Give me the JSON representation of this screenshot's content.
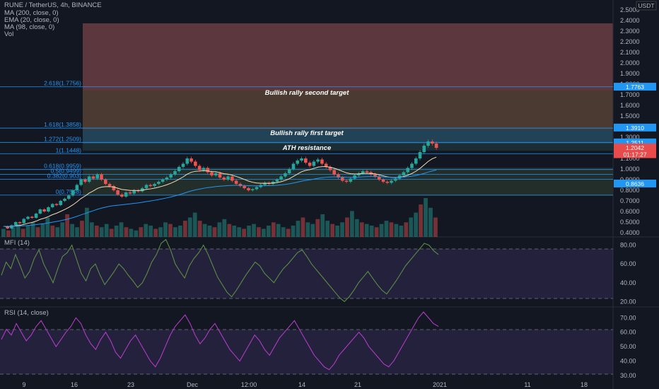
{
  "header": {
    "symbol_line": "RUNE / TetherUS, 4h, BINANCE",
    "indicators": [
      "MA (200, close, 0)",
      "EMA (20, close, 0)",
      "MA (98, close, 0)",
      "Vol"
    ],
    "currency": "USDT"
  },
  "panes": {
    "mfi_label": "MFI (14)",
    "rsi_label": "RSI (14, close)"
  },
  "annotations": {
    "second_target": "Bullish rally second target",
    "first_target": "Bullish rally first target",
    "ath": "ATH resistance"
  },
  "fib_levels": [
    {
      "label": "2.618(1.7756)",
      "value": 1.7756
    },
    {
      "label": "1.618(1.3858)",
      "value": 1.3858
    },
    {
      "label": "1.272(1.2509)",
      "value": 1.2509
    },
    {
      "label": "1(1.1448)",
      "value": 1.1448
    },
    {
      "label": "0.618(0.9959)",
      "value": 0.9959
    },
    {
      "label": "0.5(0.9499)",
      "value": 0.9499
    },
    {
      "label": "0.382(0.903)",
      "value": 0.903
    },
    {
      "label": "0(0.7548)",
      "value": 0.7548
    }
  ],
  "price_tags": [
    {
      "text": "1.7763",
      "value": 1.7763,
      "color": "#2196f3"
    },
    {
      "text": "1.3910",
      "value": 1.391,
      "color": "#2196f3"
    },
    {
      "text": "1.2511",
      "value": 1.2511,
      "color": "#2196f3"
    },
    {
      "text": "1.2042",
      "value": 1.2042,
      "color": "#e84b4b"
    },
    {
      "text": "01:17:27",
      "value": 1.14,
      "color": "#e84b4b"
    },
    {
      "text": "0.8636",
      "value": 0.8636,
      "color": "#2196f3"
    }
  ],
  "colors": {
    "background": "#131722",
    "up_candle": "#26a69a",
    "down_candle": "#ef5350",
    "fib_line": "#2196f3",
    "mfi_line": "#5d8c45",
    "rsi_line": "#b13bc4",
    "ema_line": "#f5deb3",
    "ma200_line": "#2196f3"
  },
  "chart_data": [
    {
      "type": "line",
      "pane": "price",
      "series_desc": "RUNE/USDT 4h closing price (approx)",
      "x_ticks": [
        "9",
        "16",
        "23",
        "Dec",
        "12:00",
        "14",
        "21",
        "2021",
        "11",
        "18"
      ],
      "ylim": [
        0.36,
        2.58
      ],
      "y_ticks": [
        2.5,
        2.4,
        2.3,
        2.2,
        2.1,
        2.0,
        1.9,
        1.8,
        1.7,
        1.6,
        1.5,
        1.4,
        1.3,
        1.2,
        1.1,
        1.0,
        0.9,
        0.8,
        0.7,
        0.6,
        0.5,
        0.4
      ],
      "y_tick_labels": [
        "2.5000",
        "2.4000",
        "2.3000",
        "2.2000",
        "2.1000",
        "2.0000",
        "1.9000",
        "1.8000",
        "1.7000",
        "1.6000",
        "1.5000",
        "1.4000",
        "1.3000",
        "1.2000",
        "1.1000",
        "1.0000",
        "0.9000",
        "0.8000",
        "0.7000",
        "0.6000",
        "0.5000",
        "0.4000"
      ],
      "close": [
        0.46,
        0.44,
        0.47,
        0.5,
        0.49,
        0.53,
        0.55,
        0.54,
        0.58,
        0.62,
        0.6,
        0.64,
        0.67,
        0.66,
        0.7,
        0.72,
        0.75,
        0.8,
        0.85,
        0.9,
        0.88,
        0.93,
        0.91,
        0.95,
        0.9,
        0.86,
        0.84,
        0.8,
        0.76,
        0.74,
        0.78,
        0.77,
        0.8,
        0.79,
        0.82,
        0.85,
        0.84,
        0.86,
        0.88,
        0.9,
        0.92,
        0.95,
        0.98,
        1.02,
        1.05,
        1.1,
        1.07,
        1.03,
        0.99,
        1.01,
        0.97,
        0.94,
        0.96,
        0.92,
        0.9,
        0.93,
        0.89,
        0.86,
        0.84,
        0.82,
        0.8,
        0.81,
        0.83,
        0.85,
        0.87,
        0.86,
        0.88,
        0.9,
        0.93,
        0.96,
        1.0,
        1.05,
        1.08,
        1.1,
        1.06,
        1.03,
        1.07,
        1.09,
        1.05,
        1.02,
        0.99,
        0.95,
        0.92,
        0.89,
        0.88,
        0.91,
        0.94,
        0.96,
        0.98,
        0.97,
        0.95,
        0.93,
        0.9,
        0.88,
        0.87,
        0.89,
        0.91,
        0.94,
        0.97,
        1.01,
        1.05,
        1.1,
        1.16,
        1.22,
        1.26,
        1.24,
        1.2
      ]
    },
    {
      "type": "line",
      "pane": "MFI (14)",
      "ylim": [
        15,
        88
      ],
      "y_ticks": [
        80,
        60,
        40,
        20
      ],
      "y_tick_labels": [
        "80.00",
        "60.00",
        "40.00",
        "20.00"
      ],
      "values": [
        48,
        62,
        55,
        70,
        58,
        45,
        52,
        66,
        75,
        60,
        50,
        40,
        55,
        68,
        72,
        80,
        65,
        50,
        42,
        55,
        60,
        48,
        38,
        45,
        52,
        60,
        55,
        48,
        42,
        35,
        40,
        50,
        62,
        70,
        82,
        86,
        75,
        60,
        52,
        45,
        58,
        66,
        72,
        80,
        70,
        58,
        46,
        38,
        30,
        25,
        32,
        40,
        48,
        55,
        62,
        58,
        50,
        45,
        40,
        48,
        55,
        60,
        66,
        72,
        75,
        68,
        60,
        54,
        48,
        42,
        36,
        30,
        24,
        20,
        25,
        32,
        40,
        46,
        52,
        45,
        38,
        32,
        28,
        35,
        42,
        50,
        58,
        64,
        70,
        76,
        82,
        80,
        74,
        70
      ]
    },
    {
      "type": "line",
      "pane": "RSI (14, close)",
      "ylim": [
        27,
        77
      ],
      "y_ticks": [
        70,
        60,
        50,
        40,
        30
      ],
      "y_tick_labels": [
        "70.00",
        "60.00",
        "50.00",
        "40.00",
        "30.00"
      ],
      "values": [
        55,
        62,
        58,
        66,
        60,
        54,
        58,
        64,
        68,
        62,
        56,
        50,
        55,
        60,
        64,
        70,
        66,
        58,
        52,
        48,
        55,
        60,
        54,
        46,
        42,
        48,
        54,
        58,
        52,
        46,
        40,
        36,
        42,
        50,
        58,
        64,
        68,
        72,
        66,
        58,
        52,
        56,
        62,
        66,
        60,
        54,
        48,
        44,
        40,
        46,
        52,
        58,
        54,
        48,
        44,
        50,
        56,
        60,
        64,
        68,
        62,
        56,
        50,
        44,
        40,
        36,
        34,
        38,
        44,
        48,
        52,
        56,
        60,
        56,
        50,
        46,
        42,
        38,
        36,
        40,
        46,
        52,
        58,
        64,
        70,
        74,
        70,
        66,
        64
      ]
    },
    {
      "type": "bar",
      "pane": "volume",
      "values": [
        5,
        4,
        6,
        8,
        5,
        7,
        9,
        6,
        8,
        12,
        7,
        6,
        9,
        14,
        8,
        6,
        10,
        18,
        9,
        7,
        6,
        8,
        5,
        7,
        9,
        6,
        5,
        4,
        6,
        8,
        7,
        5,
        6,
        9,
        8,
        6,
        7,
        10,
        12,
        15,
        10,
        8,
        7,
        6,
        9,
        11,
        8,
        7,
        6,
        5,
        7,
        8,
        6,
        5,
        7,
        9,
        8,
        6,
        5,
        7,
        10,
        12,
        9,
        8,
        11,
        14,
        10,
        8,
        7,
        9,
        12,
        16,
        11,
        9,
        8,
        7,
        6,
        8,
        10,
        9,
        8,
        7,
        9,
        12,
        15,
        20,
        24,
        18,
        12
      ]
    }
  ]
}
